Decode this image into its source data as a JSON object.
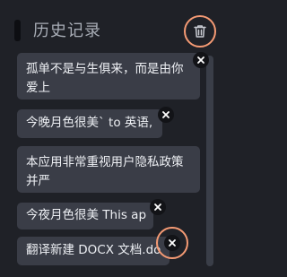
{
  "header": {
    "title": "历史记录",
    "clear_icon": "trash-icon"
  },
  "history": [
    {
      "text": "孤单不是与生俱来，而是由你爱上"
    },
    {
      "text": "今晚月色很美` to 英语,"
    },
    {
      "text": "本应用非常重视用户隐私政策并严"
    },
    {
      "text": "今夜月色很美 This ap"
    },
    {
      "text": "翻译新建 DOCX 文档.do"
    }
  ],
  "colors": {
    "background": "#1f2127",
    "card": "#3a3d47",
    "accent_ring": "#f49a74",
    "close_button": "#121317"
  }
}
